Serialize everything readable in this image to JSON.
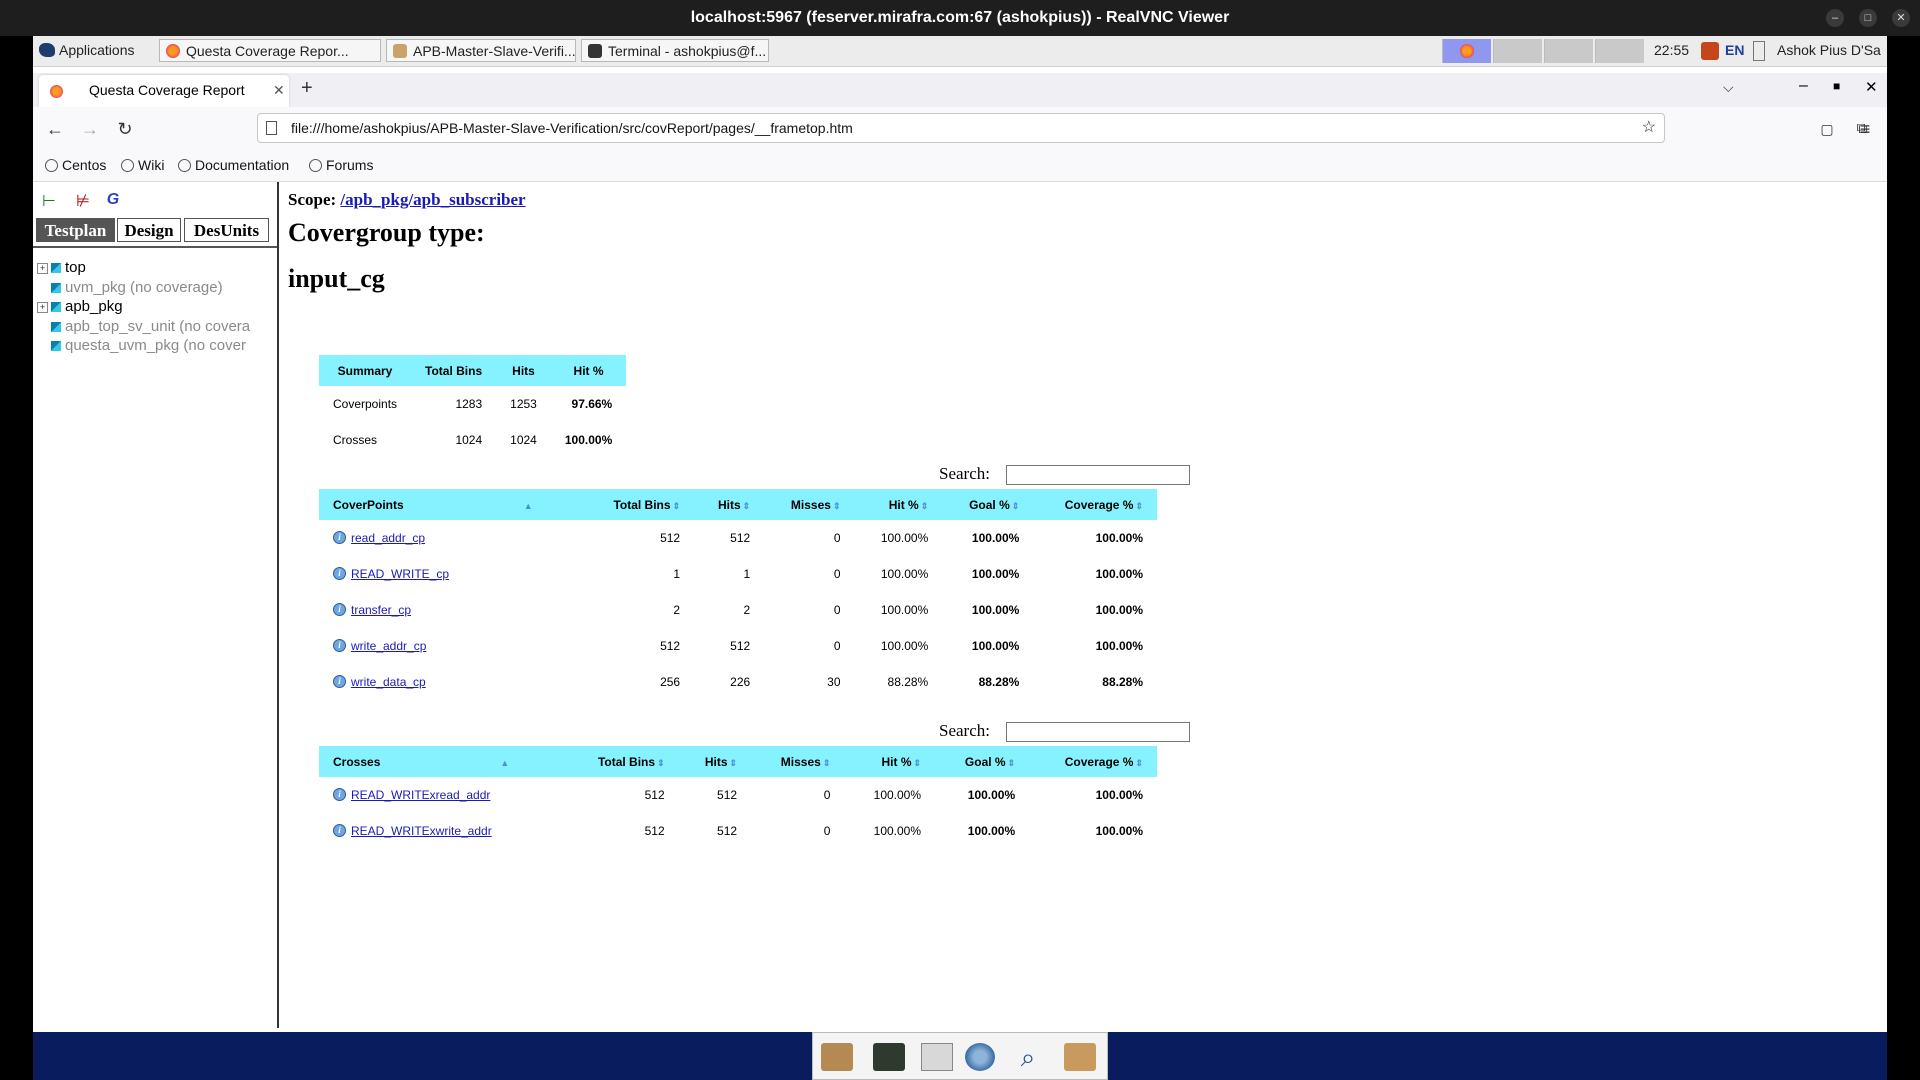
{
  "vnc": {
    "title": "localhost:5967 (feserver.mirafra.com:67 (ashokpius)) - RealVNC Viewer"
  },
  "panel": {
    "applications": "Applications",
    "tasks": [
      {
        "label": "Questa Coverage Repor..."
      },
      {
        "label": "APB-Master-Slave-Verifi..."
      },
      {
        "label": "Terminal - ashokpius@f..."
      }
    ],
    "clock": "22:55",
    "lang": "EN",
    "user": "Ashok Pius D'Sa"
  },
  "browser": {
    "tab_title": "Questa Coverage Report",
    "url": "file:///home/ashokpius/APB-Master-Slave-Verification/src/covReport/pages/__frametop.htm",
    "bookmarks": [
      "Centos",
      "Wiki",
      "Documentation",
      "Forums"
    ]
  },
  "left_panel": {
    "tabs": [
      "Testplan",
      "Design",
      "DesUnits"
    ],
    "tree": [
      {
        "label": "top",
        "expandable": true,
        "dim": false
      },
      {
        "label": "uvm_pkg (no coverage)",
        "expandable": false,
        "dim": true
      },
      {
        "label": "apb_pkg",
        "expandable": true,
        "dim": false
      },
      {
        "label": "apb_top_sv_unit (no covera",
        "expandable": false,
        "dim": true
      },
      {
        "label": "questa_uvm_pkg (no cover",
        "expandable": false,
        "dim": true
      }
    ]
  },
  "report": {
    "scope_label": "Scope:",
    "scope_link": "/apb_pkg/apb_subscriber",
    "heading1": "Covergroup type:",
    "heading2": "input_cg",
    "summary": {
      "headers": [
        "Summary",
        "Total Bins",
        "Hits",
        "Hit %"
      ],
      "rows": [
        [
          "Coverpoints",
          "1283",
          "1253",
          "97.66%"
        ],
        [
          "Crosses",
          "1024",
          "1024",
          "100.00%"
        ]
      ]
    },
    "search_label": "Search:",
    "coverpoints": {
      "headers": [
        "CoverPoints",
        "Total Bins",
        "Hits",
        "Misses",
        "Hit %",
        "Goal %",
        "Coverage %"
      ],
      "rows": [
        [
          "read_addr_cp",
          "512",
          "512",
          "0",
          "100.00%",
          "100.00%",
          "100.00%"
        ],
        [
          "READ_WRITE_cp",
          "1",
          "1",
          "0",
          "100.00%",
          "100.00%",
          "100.00%"
        ],
        [
          "transfer_cp",
          "2",
          "2",
          "0",
          "100.00%",
          "100.00%",
          "100.00%"
        ],
        [
          "write_addr_cp",
          "512",
          "512",
          "0",
          "100.00%",
          "100.00%",
          "100.00%"
        ],
        [
          "write_data_cp",
          "256",
          "226",
          "30",
          "88.28%",
          "88.28%",
          "88.28%"
        ]
      ]
    },
    "crosses": {
      "headers": [
        "Crosses",
        "Total Bins",
        "Hits",
        "Misses",
        "Hit %",
        "Goal %",
        "Coverage %"
      ],
      "rows": [
        [
          "READ_WRITExread_addr",
          "512",
          "512",
          "0",
          "100.00%",
          "100.00%",
          "100.00%"
        ],
        [
          "READ_WRITExwrite_addr",
          "512",
          "512",
          "0",
          "100.00%",
          "100.00%",
          "100.00%"
        ]
      ]
    }
  }
}
